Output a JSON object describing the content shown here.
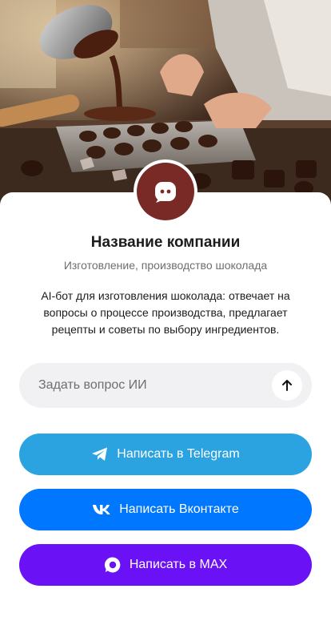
{
  "company": {
    "name": "Название компании",
    "category": "Изготовление, производство шоколада",
    "description": "AI-бот для изготовления шоколада: отвечает на вопросы о процессе производства, предлагает рецепты и советы по выбору ингредиентов."
  },
  "ask": {
    "placeholder": "Задать вопрос ИИ",
    "value": "",
    "send_icon": "arrow-up-icon"
  },
  "buttons": {
    "telegram": {
      "label": "Написать в Telegram",
      "icon": "telegram-icon",
      "color": "#2aa3e0"
    },
    "vk": {
      "label": "Написать Вконтакте",
      "icon": "vk-icon",
      "color": "#0077ff"
    },
    "max": {
      "label": "Написать в MAX",
      "icon": "max-icon",
      "color": "#6a12f5"
    }
  },
  "colors": {
    "avatar_bg": "#7a2a26",
    "input_bg": "#f1f1f3"
  }
}
